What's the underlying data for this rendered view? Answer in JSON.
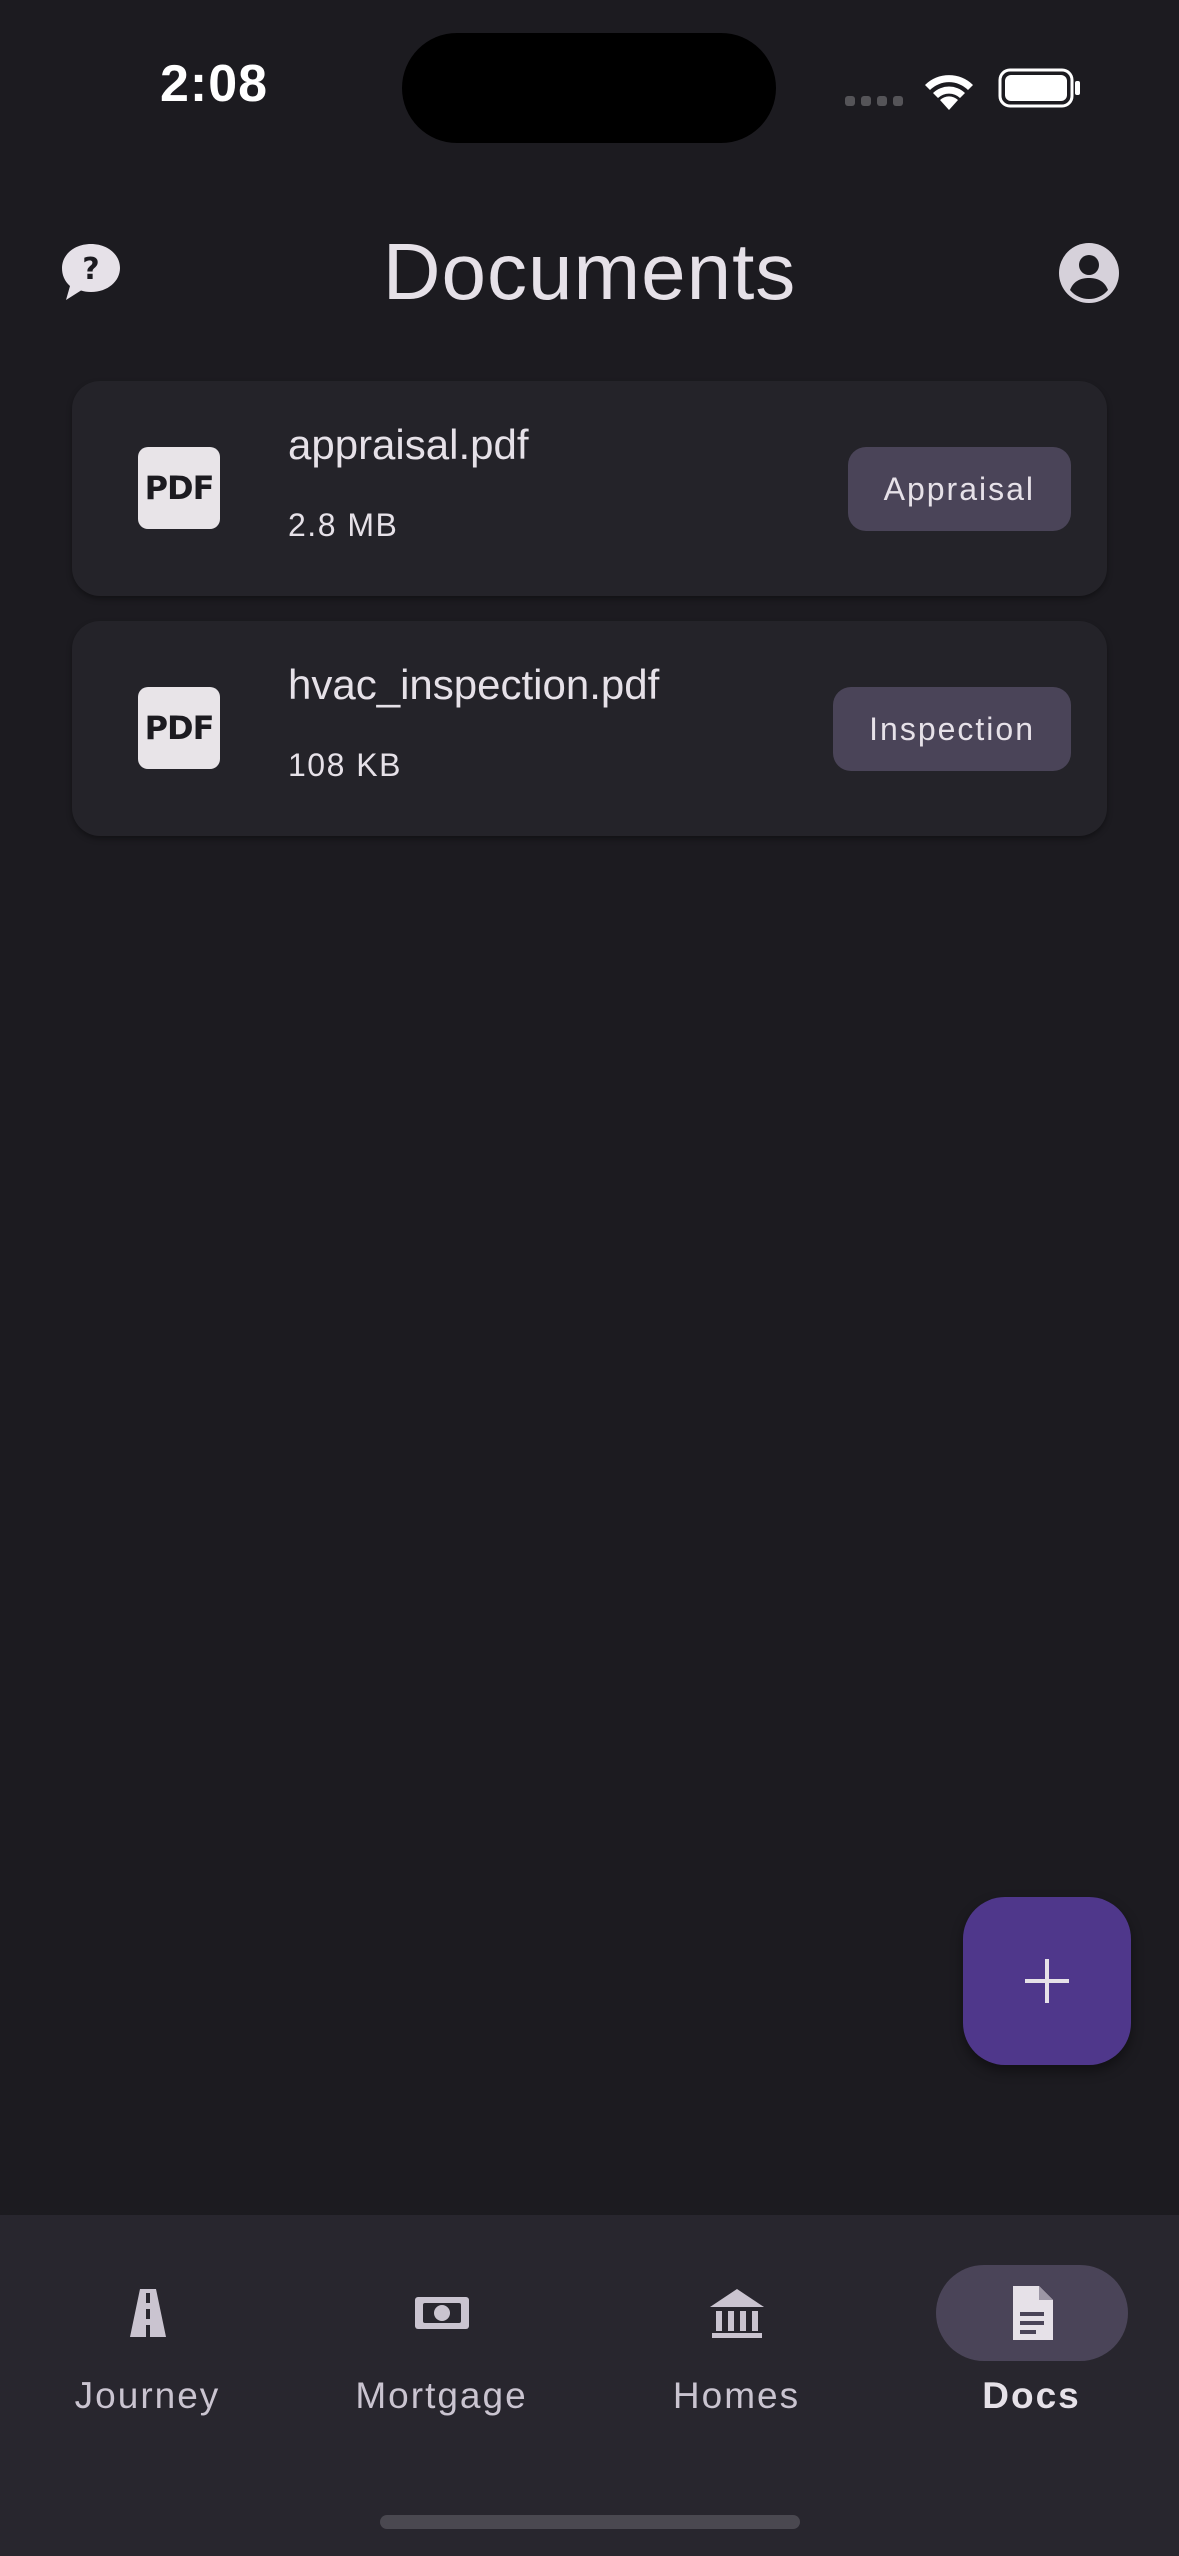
{
  "status_bar": {
    "time": "2:08"
  },
  "header": {
    "title": "Documents"
  },
  "documents": [
    {
      "name": "appraisal.pdf",
      "size": "2.8 MB",
      "tag": "Appraisal",
      "icon_text": "PDF"
    },
    {
      "name": "hvac_inspection.pdf",
      "size": "108 KB",
      "tag": "Inspection",
      "icon_text": "PDF"
    }
  ],
  "fab": {
    "icon": "plus-icon"
  },
  "nav": {
    "items": [
      {
        "label": "Journey",
        "icon": "road-icon"
      },
      {
        "label": "Mortgage",
        "icon": "money-icon"
      },
      {
        "label": "Homes",
        "icon": "bank-icon"
      },
      {
        "label": "Docs",
        "icon": "document-icon",
        "active": true
      }
    ]
  },
  "colors": {
    "background": "#1c1b20",
    "card": "#242329",
    "chip": "#4a4458",
    "fab": "#4f378b",
    "nav_bar": "#28262e"
  }
}
